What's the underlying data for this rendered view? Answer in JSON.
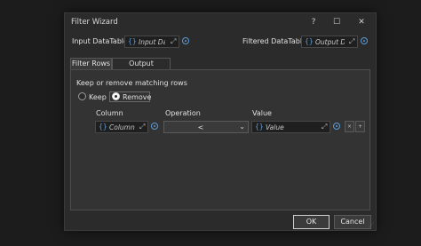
{
  "window": {
    "title": "Filter Wizard",
    "help": "?",
    "maximize": "☐",
    "close": "✕"
  },
  "input_datatable": {
    "label": "Input DataTable",
    "value": "Input Da"
  },
  "filtered_datatable": {
    "label": "Filtered DataTable",
    "value": "Output D"
  },
  "tabs": [
    {
      "label": "Filter Rows"
    },
    {
      "label": "Output Columns"
    }
  ],
  "filter": {
    "mode_label": "Keep or remove matching rows",
    "options": [
      {
        "label": "Keep",
        "selected": false
      },
      {
        "label": "Remove",
        "selected": true
      }
    ],
    "headers": {
      "column": "Column",
      "operation": "Operation",
      "value": "Value"
    },
    "row": {
      "column": "Column",
      "operation": "<",
      "value": "Value",
      "remove_btn": "×",
      "add_btn": "+"
    }
  },
  "buttons": {
    "ok": "OK",
    "cancel": "Cancel"
  },
  "icons": {
    "brace": "{}",
    "expand": "⤢",
    "chevron": "⌄",
    "grip": "⋰"
  },
  "colors": {
    "accent": "#5b9bd5",
    "background": "#2b2b2b",
    "panel": "#333333"
  }
}
